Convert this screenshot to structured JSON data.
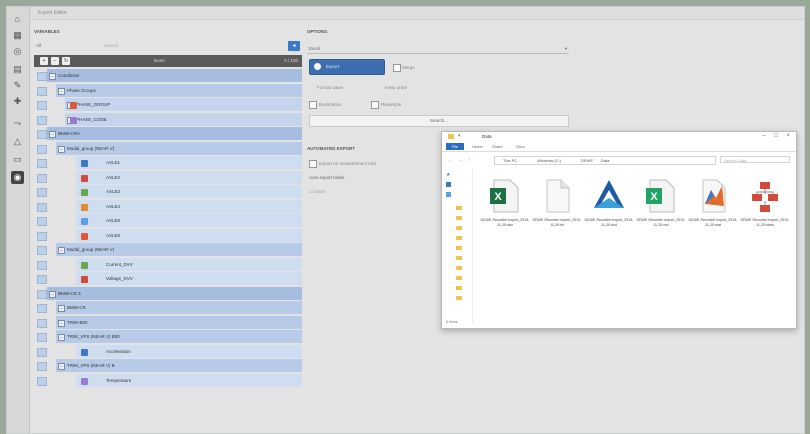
{
  "window": {
    "title": "Export Editor"
  },
  "iconbar": {
    "icons": [
      "home-icon",
      "grid-icon",
      "signal-icon",
      "chart-icon",
      "brush-icon",
      "pin-icon",
      "trend-icon",
      "triangle-icon",
      "car-icon",
      "circle-icon"
    ]
  },
  "variables": {
    "section_label": "VARIABLES",
    "filter_all": "All",
    "search_placeholder": "Search",
    "bar_mid": "None",
    "bar_end": "0 / 100",
    "rows": [
      {
        "label": "Conditions",
        "level": 0
      },
      {
        "label": "Phase Groups",
        "level": 1
      },
      {
        "label": "PHASE_GROUP",
        "level": 2,
        "color": "#e0583c"
      },
      {
        "label": "PHASE_CODE",
        "level": 2,
        "color": "#9b7ad1"
      },
      {
        "label": "BMW-CRA",
        "level": 0
      },
      {
        "label": "Modal_group (NEAR V)",
        "level": 1
      },
      {
        "label": "AXLE1",
        "level": 3,
        "color": "#3d79c7"
      },
      {
        "label": "AXLE2",
        "level": 3,
        "color": "#d24a3a"
      },
      {
        "label": "AXLE3",
        "level": 3,
        "color": "#6aa84f"
      },
      {
        "label": "AXLE4",
        "level": 3,
        "color": "#e38b2f"
      },
      {
        "label": "AXLE5",
        "level": 3,
        "color": "#5fa0e0"
      },
      {
        "label": "AXLE6",
        "level": 3,
        "color": "#e0583c"
      },
      {
        "label": "Modal_group (NEAR V)",
        "level": 1
      },
      {
        "label": "Current_DVV",
        "level": 3,
        "color": "#6aa84f"
      },
      {
        "label": "Voltage_DVV",
        "level": 3,
        "color": "#d24a3a"
      },
      {
        "label": "BMW-CR 3",
        "level": 0
      },
      {
        "label": "BMW-CR",
        "level": 1
      },
      {
        "label": "TRIM-B00",
        "level": 1
      },
      {
        "label": "TRIM_VPS (NEAR V) B00",
        "level": 1
      },
      {
        "label": "Acceleration",
        "level": 3,
        "color": "#3d79c7"
      },
      {
        "label": "TRIM_VPS (NEAR V) B",
        "level": 1
      },
      {
        "label": "Temperature",
        "level": 3,
        "color": "#9b7ad1"
      }
    ]
  },
  "options": {
    "section_label": "OPTIONS",
    "dropdown_value": "Excel",
    "selected_button": "Export",
    "check_right": "Merge",
    "opt_a": "Format wave",
    "opt_b": "Keep order",
    "check_a": "Decimation",
    "check_b": "Resample",
    "search_button": "Search..."
  },
  "automated": {
    "section_label": "AUTOMATED EXPORT",
    "check_label": "Export on measurement end",
    "folder_label": "Auto export folder",
    "folder_value": "C:\\Data\\"
  },
  "explorer": {
    "title": "Data",
    "tab_file": "File",
    "tabs": [
      "Home",
      "Share",
      "View"
    ],
    "path": [
      "This PC",
      "Windows (C:)",
      "DEWE",
      "Data"
    ],
    "search_placeholder": "Search Data",
    "status": "6 items",
    "files": [
      {
        "name": "DEWE-Recorder export_2019-11-29.xlsx",
        "icon": "excel-icon"
      },
      {
        "name": "DEWE-Recorder export_2019-11-29.txt",
        "icon": "document-icon"
      },
      {
        "name": "DEWE-Recorder export_2019-11-29.dxd",
        "icon": "dewesoft-icon"
      },
      {
        "name": "DEWE-Recorder export_2019-11-29.csv",
        "icon": "excel-csv-icon"
      },
      {
        "name": "DEWE-Recorder export_2019-11-29.mat",
        "icon": "matlab-icon"
      },
      {
        "name": "DEWE-Recorder export_2019-11-29.tdms",
        "icon": "flowchart-icon"
      }
    ]
  }
}
